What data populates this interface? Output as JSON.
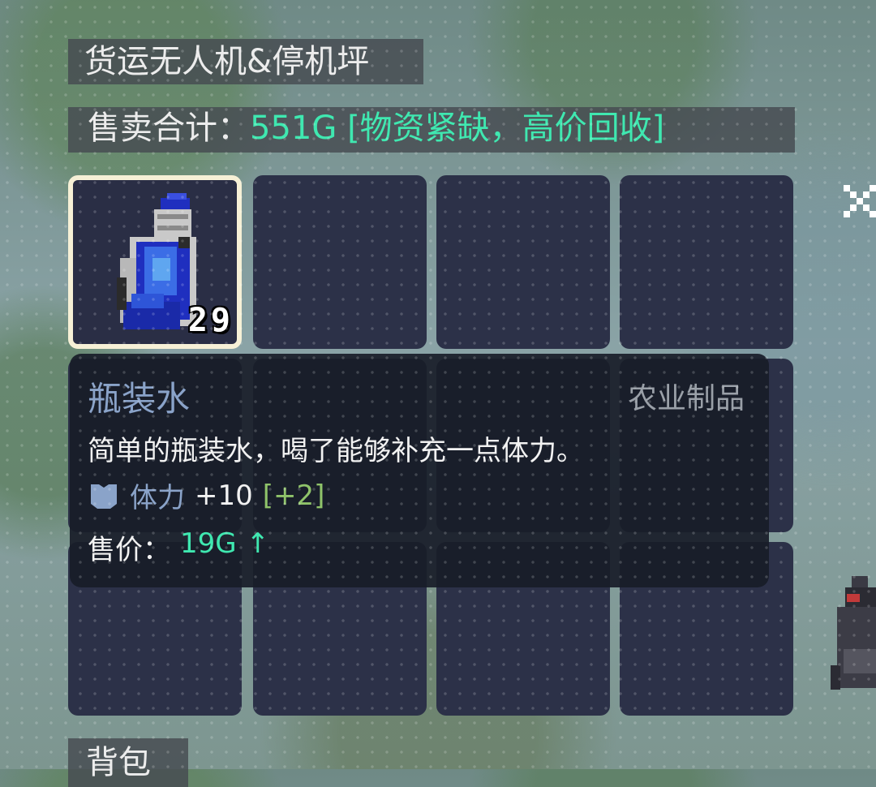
{
  "panel": {
    "title": "货运无人机&停机坪",
    "sale_label": "售卖合计：",
    "sale_total": "551G",
    "sale_note": "[物资紧缺，高价回收]"
  },
  "grid": {
    "selected_item": {
      "name": "瓶装水",
      "quantity": "29",
      "icon": "water-bottle-icon"
    }
  },
  "tooltip": {
    "name": "瓶装水",
    "category": "农业制品",
    "description": "简单的瓶装水，喝了能够补充一点体力。",
    "stat_icon": "shield-icon",
    "stat_name": "体力",
    "stat_value": "+10",
    "stat_bonus": "[+2]",
    "price_label": "售价：",
    "price_value": "19G",
    "price_trend": "↑"
  },
  "bag_label": "背包",
  "colors": {
    "accent_green": "#3fe8b0",
    "cell_bg": "#2c3148",
    "selected_border": "#f6f0d6",
    "stat_blue": "#8aa3c9",
    "bonus_green": "#8fc36a"
  }
}
